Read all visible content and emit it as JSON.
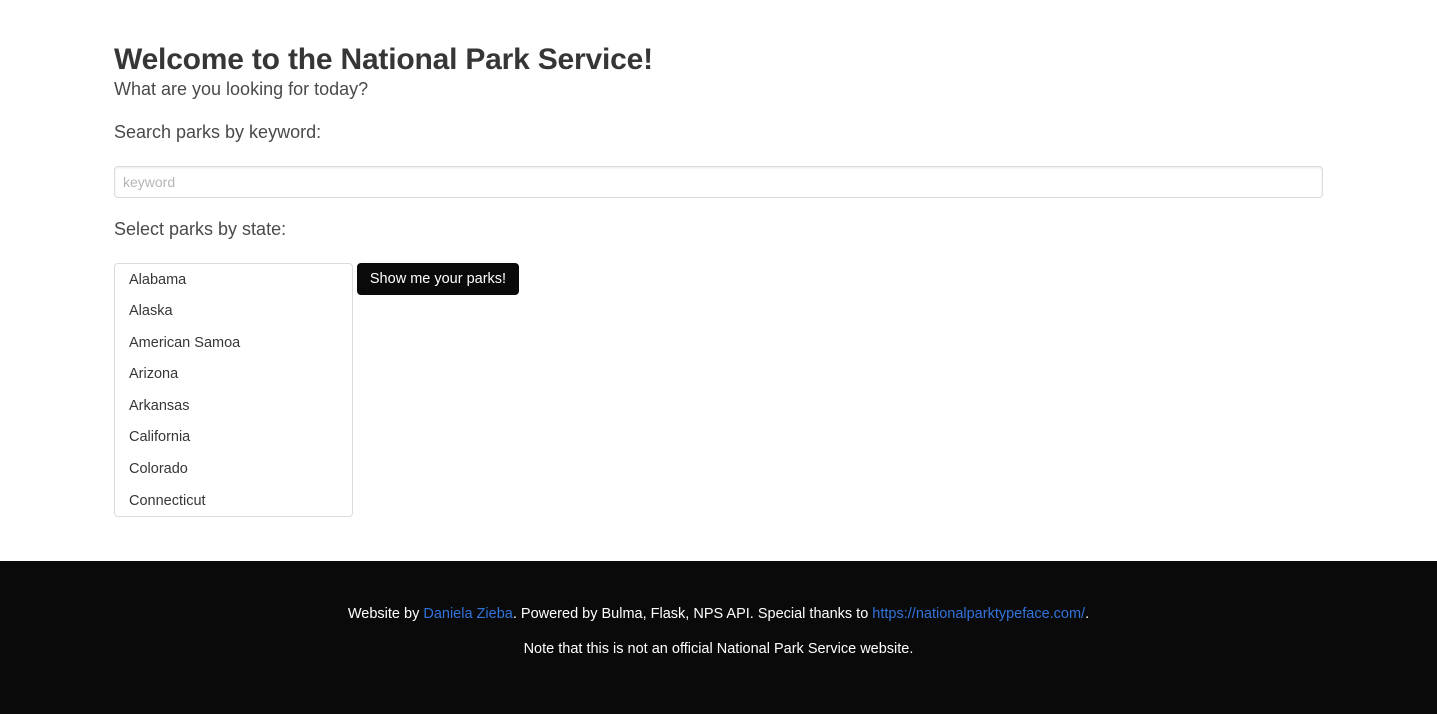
{
  "header": {
    "title": "Welcome to the National Park Service!",
    "subtitle": "What are you looking for today?"
  },
  "search": {
    "keyword_label": "Search parks by keyword:",
    "keyword_placeholder": "keyword",
    "keyword_value": "",
    "state_label": "Select parks by state:",
    "states": [
      "Alabama",
      "Alaska",
      "American Samoa",
      "Arizona",
      "Arkansas",
      "California",
      "Colorado",
      "Connecticut"
    ],
    "submit_label": "Show me your parks!"
  },
  "footer": {
    "prefix": "Website by ",
    "author_link": "Daniela Zieba",
    "middle": ". Powered by Bulma, Flask, NPS API. Special thanks to ",
    "thanks_link": "https://nationalparktypeface.com/",
    "suffix": ".",
    "note": "Note that this is not an official National Park Service website."
  },
  "colors": {
    "footer_background": "#0a0a0a",
    "link": "#3273dc",
    "button_background": "#0a0a0a",
    "text": "#363636"
  }
}
